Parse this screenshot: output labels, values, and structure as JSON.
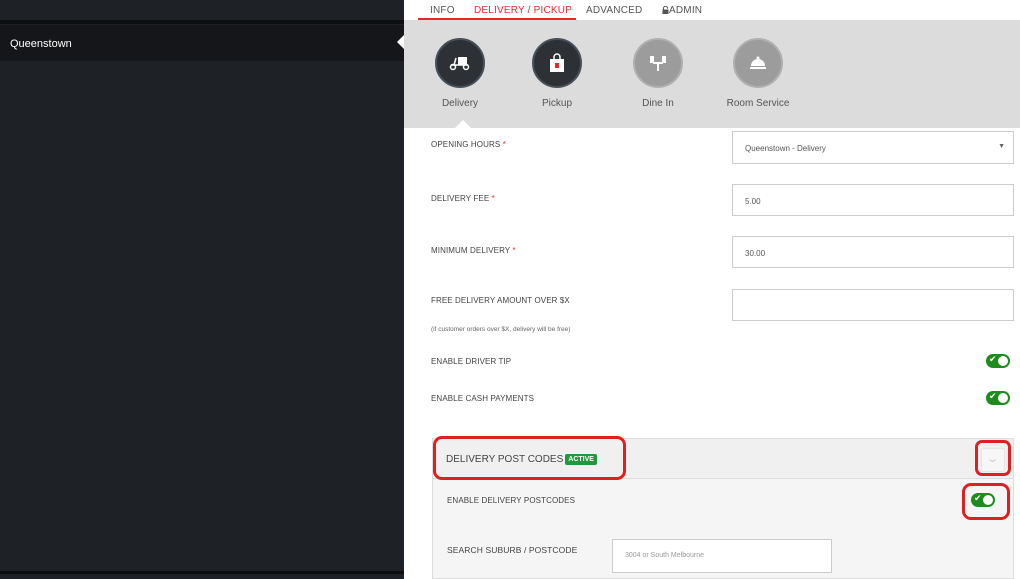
{
  "sidebar": {
    "items": [
      {
        "label": "Queenstown"
      }
    ]
  },
  "tabs": [
    {
      "label": "INFO"
    },
    {
      "label": "DELIVERY / PICKUP"
    },
    {
      "label": "ADVANCED"
    },
    {
      "label": "ADMIN",
      "icon": "lock-icon"
    }
  ],
  "order_types": [
    {
      "label": "Delivery",
      "icon": "scooter-icon"
    },
    {
      "label": "Pickup",
      "icon": "bag-icon"
    },
    {
      "label": "Dine In",
      "icon": "dining-icon"
    },
    {
      "label": "Room Service",
      "icon": "cloche-icon"
    }
  ],
  "form": {
    "opening_hours": {
      "label": "OPENING HOURS",
      "required": "*",
      "value": "Queenstown - Delivery"
    },
    "delivery_fee": {
      "label": "DELIVERY FEE",
      "required": "*",
      "value": "5.00"
    },
    "minimum_delivery": {
      "label": "MINIMUM DELIVERY",
      "required": "*",
      "value": "30.00"
    },
    "free_delivery": {
      "label": "FREE DELIVERY AMOUNT OVER $X",
      "hint": "(if customer orders over $X, delivery will be free)",
      "value": ""
    },
    "driver_tip": {
      "label": "ENABLE DRIVER TIP",
      "enabled": true
    },
    "cash_payments": {
      "label": "ENABLE CASH PAYMENTS",
      "enabled": true
    }
  },
  "postcodes": {
    "title": "DELIVERY POST CODES",
    "badge": "ACTIVE",
    "enable_label": "ENABLE DELIVERY POSTCODES",
    "enabled": true,
    "search_label": "SEARCH SUBURB / POSTCODE",
    "search_placeholder": "3004 or South Melbourne"
  },
  "colors": {
    "accent": "#e02b2b",
    "toggle_on": "#1c8c1c",
    "badge": "#1c9a3c",
    "sidebar": "#1e2125"
  }
}
